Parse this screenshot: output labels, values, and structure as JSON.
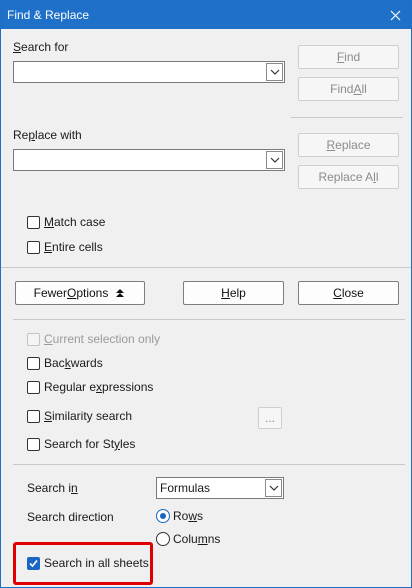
{
  "window": {
    "title": "Find & Replace",
    "close_icon": "close-icon"
  },
  "search": {
    "label_pre": "",
    "label_u": "S",
    "label_post": "earch for",
    "value": "",
    "find_pre": "",
    "find_u": "F",
    "find_post": "ind",
    "find_all_pre": "Find ",
    "find_all_u": "A",
    "find_all_post": "ll"
  },
  "replace": {
    "label_pre": "Re",
    "label_u": "p",
    "label_post": "lace with",
    "value": "",
    "replace_pre": "",
    "replace_u": "R",
    "replace_post": "eplace",
    "replace_all_pre": "Replace A",
    "replace_all_u": "l",
    "replace_all_post": "l"
  },
  "options": {
    "match_case_pre": "",
    "match_case_u": "M",
    "match_case_post": "atch case",
    "entire_cells_pre": "",
    "entire_cells_u": "E",
    "entire_cells_post": "ntire cells"
  },
  "buttons": {
    "fewer_pre": "Fewer ",
    "fewer_u": "O",
    "fewer_post": "ptions",
    "help_pre": "",
    "help_u": "H",
    "help_post": "elp",
    "close_pre": "",
    "close_u": "C",
    "close_post": "lose"
  },
  "more": {
    "current_selection_pre": "",
    "current_selection_u": "C",
    "current_selection_post": "urrent selection only",
    "backwards_pre": "Bac",
    "backwards_u": "k",
    "backwards_post": "wards",
    "regex_pre": "Regular e",
    "regex_u": "x",
    "regex_post": "pressions",
    "similarity_pre": "",
    "similarity_u": "S",
    "similarity_post": "imilarity search",
    "similarity_btn": "...",
    "styles_pre": "Search for St",
    "styles_u": "y",
    "styles_post": "les"
  },
  "search_in": {
    "label_pre": "Search i",
    "label_u": "n",
    "label_post": "",
    "value": "Formulas"
  },
  "direction": {
    "label": "Search direction",
    "rows_pre": "Ro",
    "rows_u": "w",
    "rows_post": "s",
    "columns_pre": "Colu",
    "columns_u": "m",
    "columns_post": "ns",
    "selected": "rows"
  },
  "all_sheets": {
    "label": "Search in all sheets",
    "checked": true
  },
  "colors": {
    "accent": "#1967c2",
    "titlebar": "#1e70c8",
    "highlight": "#e00000"
  }
}
